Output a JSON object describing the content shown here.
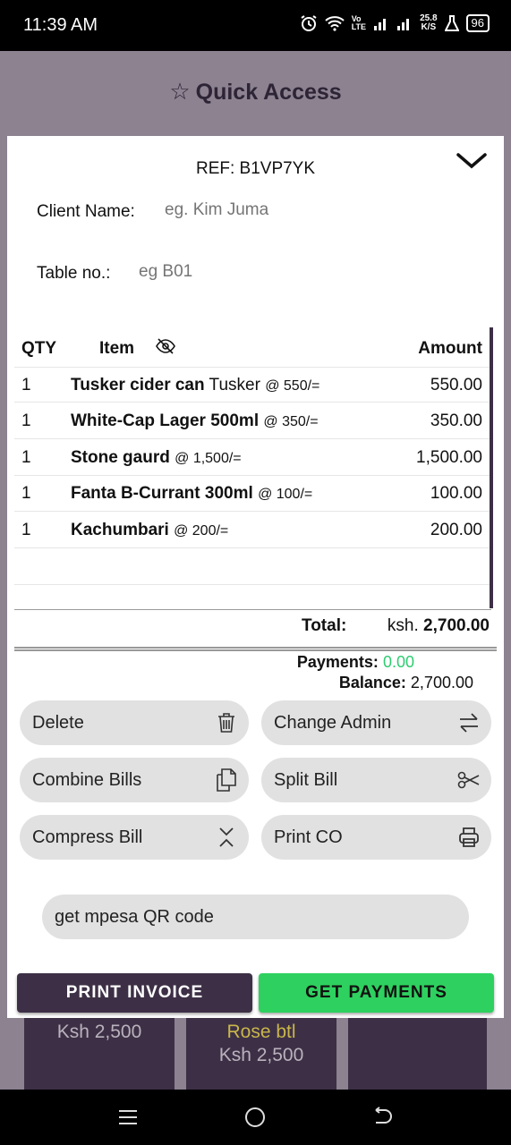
{
  "status_bar": {
    "time": "11:39 AM",
    "vo": "Vo",
    "lte": "LTE",
    "speed_top": "25.8",
    "speed_bottom": "K/S",
    "battery": "96"
  },
  "header": {
    "title": "Quick Access"
  },
  "background_tiles": [
    {
      "name": "",
      "price": "Ksh 2,500"
    },
    {
      "name": "Rose btl",
      "price": "Ksh 2,500"
    },
    {
      "name": "",
      "price": ""
    }
  ],
  "bill": {
    "ref": "REF: B1VP7YK",
    "client_label": "Client Name:",
    "client_placeholder": "eg. Kim Juma",
    "table_label": "Table no.:",
    "table_placeholder": "eg B01",
    "columns": {
      "qty": "QTY",
      "item": "Item",
      "amount": "Amount"
    },
    "rows": [
      {
        "qty": "1",
        "name": "Tusker cider can",
        "variant": "Tusker",
        "price": "@ 550/=",
        "amount": "550.00"
      },
      {
        "qty": "1",
        "name": "White-Cap Lager 500ml",
        "variant": "",
        "price": "@ 350/=",
        "amount": "350.00"
      },
      {
        "qty": "1",
        "name": "Stone gaurd",
        "variant": "",
        "price": "@ 1,500/=",
        "amount": "1,500.00"
      },
      {
        "qty": "1",
        "name": "Fanta B-Currant 300ml",
        "variant": "",
        "price": "@ 100/=",
        "amount": "100.00"
      },
      {
        "qty": "1",
        "name": "Kachumbari",
        "variant": "",
        "price": "@ 200/=",
        "amount": "200.00"
      }
    ],
    "total_label": "Total:",
    "total_currency": "ksh.",
    "total_value": "2,700.00",
    "payments_label": "Payments:",
    "payments_value": "0.00",
    "balance_label": "Balance:",
    "balance_value": "2,700.00"
  },
  "actions": {
    "delete": "Delete",
    "change_admin": "Change Admin",
    "combine_bills": "Combine Bills",
    "split_bill": "Split Bill",
    "compress_bill": "Compress Bill",
    "print_co": "Print CO",
    "mpesa": "get mpesa QR code",
    "print_invoice": "PRINT INVOICE",
    "get_payments": "GET PAYMENTS"
  },
  "colors": {
    "accent_dark": "#3d3046",
    "accent_green": "#2ed15f",
    "payment_green": "#2ecc71"
  }
}
